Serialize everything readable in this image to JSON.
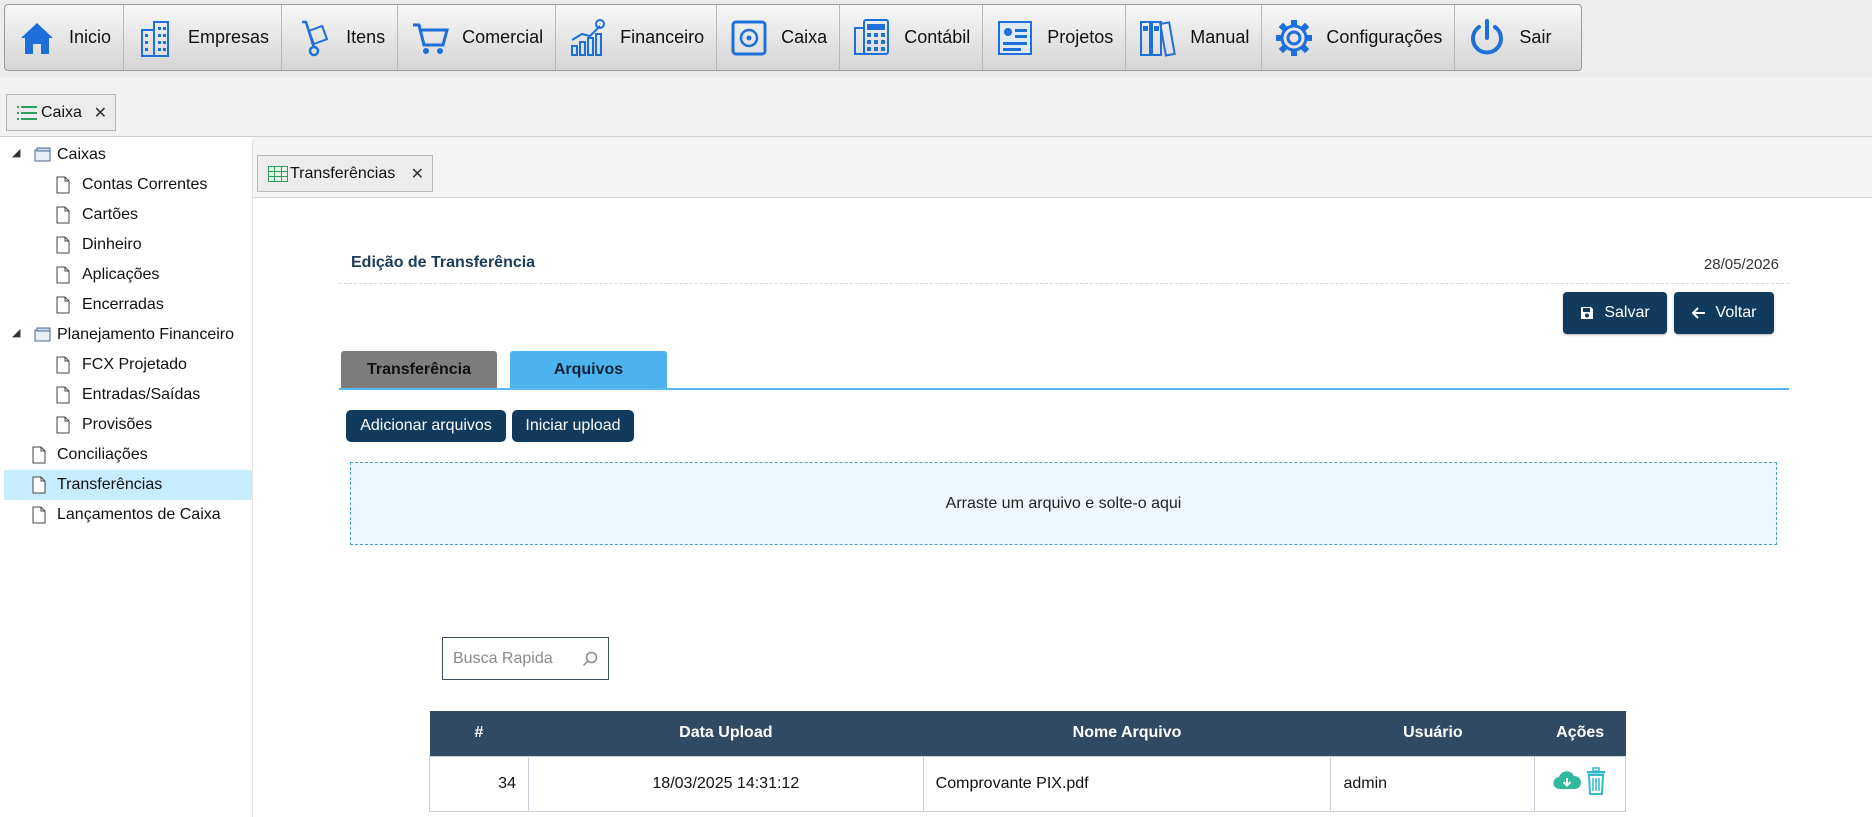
{
  "menu": {
    "items": [
      {
        "label": "Inicio",
        "icon": "home-icon"
      },
      {
        "label": "Empresas",
        "icon": "building-icon"
      },
      {
        "label": "Itens",
        "icon": "hand-truck-icon"
      },
      {
        "label": "Comercial",
        "icon": "cart-icon"
      },
      {
        "label": "Financeiro",
        "icon": "growth-chart-icon"
      },
      {
        "label": "Caixa",
        "icon": "safe-icon"
      },
      {
        "label": "Contábil",
        "icon": "calculator-icon"
      },
      {
        "label": "Projetos",
        "icon": "project-board-icon"
      },
      {
        "label": "Manual",
        "icon": "binders-icon"
      },
      {
        "label": "Configurações",
        "icon": "gear-icon"
      },
      {
        "label": "Sair",
        "icon": "power-icon"
      }
    ],
    "icon_color": "#1e6fd9"
  },
  "module_tab": {
    "label": "Caixa",
    "close": "✕"
  },
  "tree": {
    "caixas": "Caixas",
    "contas_correntes": "Contas Correntes",
    "cartoes": "Cartões",
    "dinheiro": "Dinheiro",
    "aplicacoes": "Aplicações",
    "encerradas": "Encerradas",
    "planejamento": "Planejamento Financeiro",
    "fcx_projetado": "FCX Projetado",
    "entradas_saidas": "Entradas/Saídas",
    "provisoes": "Provisões",
    "conciliacoes": "Conciliações",
    "transferencias": "Transferências",
    "lancamentos": "Lançamentos de Caixa"
  },
  "subtab": {
    "label": "Transferências",
    "close": "✕"
  },
  "form": {
    "title": "Edição de Transferência",
    "date": "28/05/2026",
    "save_label": "Salvar",
    "back_label": "Voltar",
    "tab_transferencia": "Transferência",
    "tab_arquivos": "Arquivos",
    "add_files_label": "Adicionar arquivos",
    "start_upload_label": "Iniciar upload",
    "dropzone_text": "Arraste um arquivo e solte-o aqui",
    "search_placeholder": "Busca Rapida"
  },
  "files_table": {
    "headers": {
      "id": "#",
      "date": "Data Upload",
      "name": "Nome Arquivo",
      "user": "Usuário",
      "actions": "Ações"
    },
    "rows": [
      {
        "id": "34",
        "date": "18/03/2025 14:31:12",
        "name": "Comprovante PIX.pdf",
        "user": "admin"
      }
    ]
  },
  "colors": {
    "primary_dark": "#123a5c",
    "tab_active": "#4db3ef",
    "tab_inactive": "#7d7d7d",
    "table_header": "#314a63",
    "selected_row": "#c8ecff",
    "download_icon": "#2fb99a",
    "delete_icon": "#2fb9c9"
  }
}
